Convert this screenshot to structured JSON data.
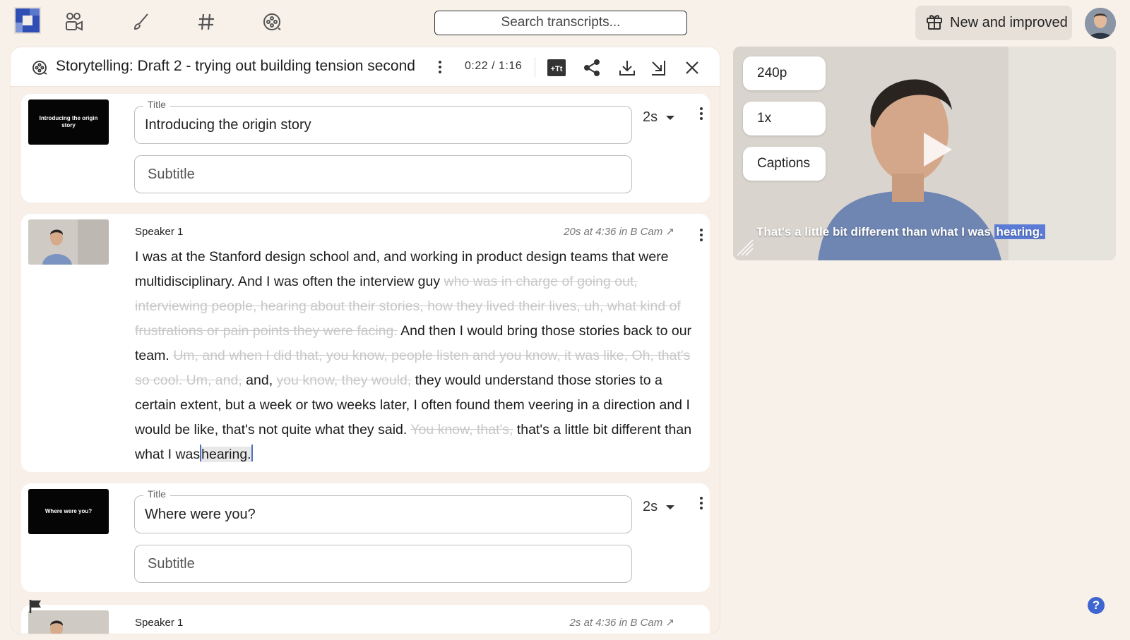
{
  "topbar": {
    "search_placeholder": "Search transcripts...",
    "news_label": "New and improved",
    "nav_icons": [
      "people-camera-icon",
      "brush-icon",
      "hashtag-icon",
      "film-reel-icon"
    ]
  },
  "editor": {
    "title": "Storytelling: Draft 2 - trying out building tension second",
    "timecode": "0:22 / 1:16",
    "toolbar_icons": [
      "more-icon",
      "add-text-icon",
      "share-icon",
      "download-icon",
      "export-icon",
      "close-icon"
    ],
    "add_text_label": "+Tt"
  },
  "cards": [
    {
      "type": "title",
      "thumb_text": "Introducing the origin story",
      "title_label": "Title",
      "title_value": "Introducing the origin story",
      "subtitle_placeholder": "Subtitle",
      "duration": "2s"
    },
    {
      "type": "speaker",
      "speaker": "Speaker 1",
      "clip_info": "20s at 4:36 in B Cam",
      "segments": {
        "s1": "I was at the Stanford design school and, and working in product design teams that were multidisciplinary. And I was often the interview guy",
        "x1": "who was in charge of going out, interviewing people, hearing about their stories, how they lived their lives, uh, what kind of frustrations or pain points they were facing.",
        "s2": "And then I would bring those stories back to our team.",
        "x2": "Um, and when I did that, you know, people listen and you know, it was like, Oh, that's so cool. Um, and,",
        "s3": "and,",
        "x3": "you know, they would,",
        "s4": "they would understand those stories to a certain extent, but a week or two weeks later, I often found them veering in a direction and I would be like, that's not quite what they said.",
        "x4": "You know, that's,",
        "s5": "that's a little bit different than what I was",
        "s6": "hearing."
      }
    },
    {
      "type": "title",
      "thumb_text": "Where were you?",
      "title_label": "Title",
      "title_value": "Where were you?",
      "subtitle_placeholder": "Subtitle",
      "duration": "2s"
    },
    {
      "type": "speaker",
      "speaker": "Speaker 1",
      "clip_info": "2s at 4:36 in B Cam"
    }
  ],
  "video": {
    "quality": "240p",
    "speed": "1x",
    "captions_label": "Captions",
    "caption_text": "That's a little bit different than what I was",
    "caption_highlight": "hearing."
  },
  "help_label": "?",
  "colors": {
    "background": "#f8f1ea",
    "accent": "#3f66d0",
    "highlight": "#5b7bd6"
  }
}
